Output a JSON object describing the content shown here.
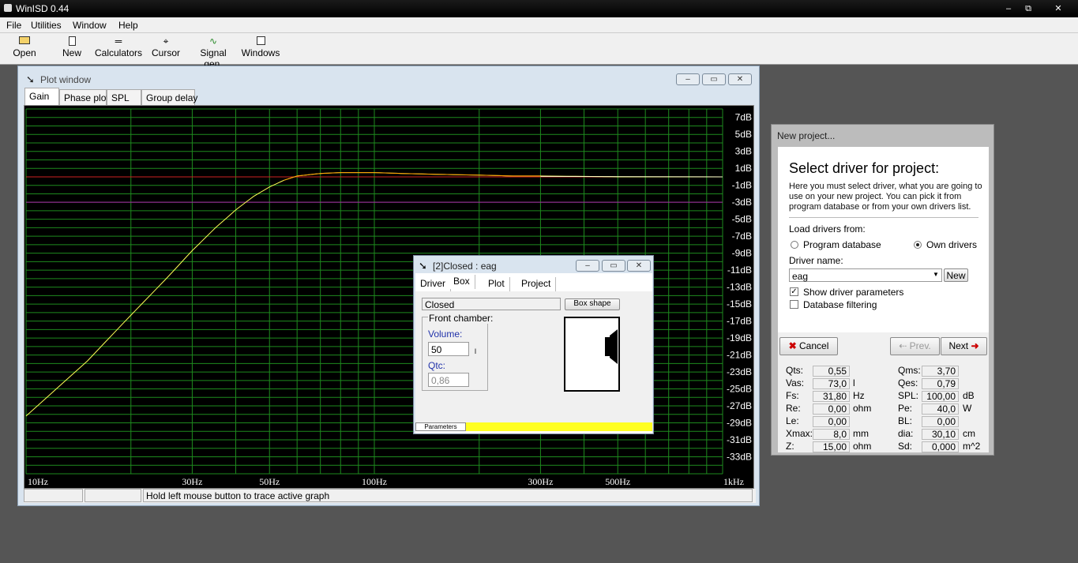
{
  "app": {
    "title": "WinISD 0.44",
    "controls": {
      "minimize": "–",
      "maximize": "⧉",
      "close": "✕"
    }
  },
  "menu": [
    "File",
    "Utilities",
    "Window",
    "Help"
  ],
  "toolbar": [
    {
      "label": "Open",
      "icon": "open-folder-icon",
      "glyph": "📂"
    },
    {
      "label": "New",
      "icon": "new-document-icon",
      "glyph": "▯"
    },
    {
      "label": "Calculators",
      "icon": "calculator-icon",
      "glyph": "⸎"
    },
    {
      "label": "Cursor",
      "icon": "crosshair-icon",
      "glyph": "⌖"
    },
    {
      "label": "Signal gen.",
      "icon": "sine-wave-icon",
      "glyph": "∿"
    },
    {
      "label": "Windows",
      "icon": "windows-icon",
      "glyph": "▢"
    }
  ],
  "plot_window": {
    "title": "Plot window",
    "tabs": [
      "Gain",
      "Phase plot",
      "SPL",
      "Group delay"
    ],
    "active_tab": "Gain",
    "status": {
      "hint": "Hold left mouse button to trace active graph"
    },
    "controls": {
      "minimize": "–",
      "maximize": "▭",
      "close": "✕"
    }
  },
  "chart_data": {
    "type": "line",
    "title": "",
    "xlabel": "",
    "ylabel": "",
    "x_scale": "log",
    "xlim": [
      10,
      1000
    ],
    "ylim": [
      -35,
      8
    ],
    "grid": true,
    "x_tick_labels": [
      {
        "v": 10,
        "t": "10Hz"
      },
      {
        "v": 30,
        "t": "30Hz"
      },
      {
        "v": 50,
        "t": "50Hz"
      },
      {
        "v": 100,
        "t": "100Hz"
      },
      {
        "v": 300,
        "t": "300Hz"
      },
      {
        "v": 500,
        "t": "500Hz"
      },
      {
        "v": 1000,
        "t": "1kHz"
      }
    ],
    "y_tick_labels": [
      {
        "v": 7,
        "t": "7dB"
      },
      {
        "v": 5,
        "t": "5dB"
      },
      {
        "v": 3,
        "t": "3dB"
      },
      {
        "v": 1,
        "t": "1dB"
      },
      {
        "v": -1,
        "t": "-1dB"
      },
      {
        "v": -3,
        "t": "-3dB"
      },
      {
        "v": -5,
        "t": "-5dB"
      },
      {
        "v": -7,
        "t": "-7dB"
      },
      {
        "v": -9,
        "t": "-9dB"
      },
      {
        "v": -11,
        "t": "-11dB"
      },
      {
        "v": -13,
        "t": "-13dB"
      },
      {
        "v": -15,
        "t": "-15dB"
      },
      {
        "v": -17,
        "t": "-17dB"
      },
      {
        "v": -19,
        "t": "-19dB"
      },
      {
        "v": -21,
        "t": "-21dB"
      },
      {
        "v": -23,
        "t": "-23dB"
      },
      {
        "v": -25,
        "t": "-25dB"
      },
      {
        "v": -27,
        "t": "-27dB"
      },
      {
        "v": -29,
        "t": "-29dB"
      },
      {
        "v": -31,
        "t": "-31dB"
      },
      {
        "v": -33,
        "t": "-33dB"
      }
    ],
    "reference_lines": [
      {
        "y": 0,
        "color": "#cc2222"
      },
      {
        "y": -3,
        "color": "#aa22aa"
      }
    ],
    "series": [
      {
        "color": "#ffff55",
        "highlight_color": "#ffa000",
        "x": [
          10,
          15,
          20,
          25,
          30,
          35,
          40,
          45,
          50,
          55,
          60,
          70,
          80,
          90,
          100,
          120,
          150,
          200,
          250,
          300,
          400,
          500,
          600,
          700,
          800,
          1000
        ],
        "y": [
          -28.2,
          -21.7,
          -16.3,
          -12.2,
          -8.7,
          -6.0,
          -3.9,
          -2.3,
          -1.2,
          -0.4,
          0.1,
          0.4,
          0.5,
          0.5,
          0.5,
          0.4,
          0.3,
          0.2,
          0.1,
          0.1,
          0.05,
          0.0,
          0.0,
          0.0,
          0.0,
          0.0
        ]
      }
    ]
  },
  "box_window": {
    "title": "[2]Closed : eag",
    "tabs": [
      "Driver",
      "Box",
      "Plot",
      "Project"
    ],
    "active_tab": "Box",
    "box_type": "Closed",
    "box_shape_button": "Box shape",
    "front_chamber": "Front chamber:",
    "volume_label": "Volume:",
    "volume_value": "50",
    "volume_unit": "l",
    "qtc_label": "Qtc:",
    "qtc_value": "0,86",
    "bottom_tab": "Parameters",
    "controls": {
      "minimize": "–",
      "maximize": "▭",
      "close": "✕"
    }
  },
  "new_project": {
    "title": "New project...",
    "heading": "Select driver for project:",
    "description": "Here you must select driver, what you are going to use on your new project. You can pick it from program database or from your own drivers list.",
    "load_from": "Load drivers from:",
    "radio_program": "Program database",
    "radio_own": "Own drivers",
    "selected_source": "Own drivers",
    "driver_name_label": "Driver name:",
    "driver_name_value": "eag",
    "new_button": "New",
    "show_params": "Show driver parameters",
    "show_params_checked": true,
    "db_filter": "Database filtering",
    "db_filter_checked": false,
    "cancel": "Cancel",
    "prev": "Prev.",
    "next": "Next",
    "params_left": [
      {
        "label": "Qts:",
        "value": "0,55",
        "unit": ""
      },
      {
        "label": "Vas:",
        "value": "73,0",
        "unit": "l"
      },
      {
        "label": "Fs:",
        "value": "31,80",
        "unit": "Hz"
      },
      {
        "label": "Re:",
        "value": "0,00",
        "unit": "ohm"
      },
      {
        "label": "Le:",
        "value": "0,00",
        "unit": ""
      },
      {
        "label": "Xmax:",
        "value": "8,0",
        "unit": "mm"
      },
      {
        "label": "Z:",
        "value": "15,00",
        "unit": "ohm"
      }
    ],
    "params_right": [
      {
        "label": "Qms:",
        "value": "3,70",
        "unit": ""
      },
      {
        "label": "Qes:",
        "value": "0,79",
        "unit": ""
      },
      {
        "label": "SPL:",
        "value": "100,00",
        "unit": "dB"
      },
      {
        "label": "Pe:",
        "value": "40,0",
        "unit": "W"
      },
      {
        "label": "BL:",
        "value": "0,00",
        "unit": ""
      },
      {
        "label": "dia:",
        "value": "30,10",
        "unit": "cm"
      },
      {
        "label": "Sd:",
        "value": "0,000",
        "unit": "m^2"
      }
    ]
  }
}
